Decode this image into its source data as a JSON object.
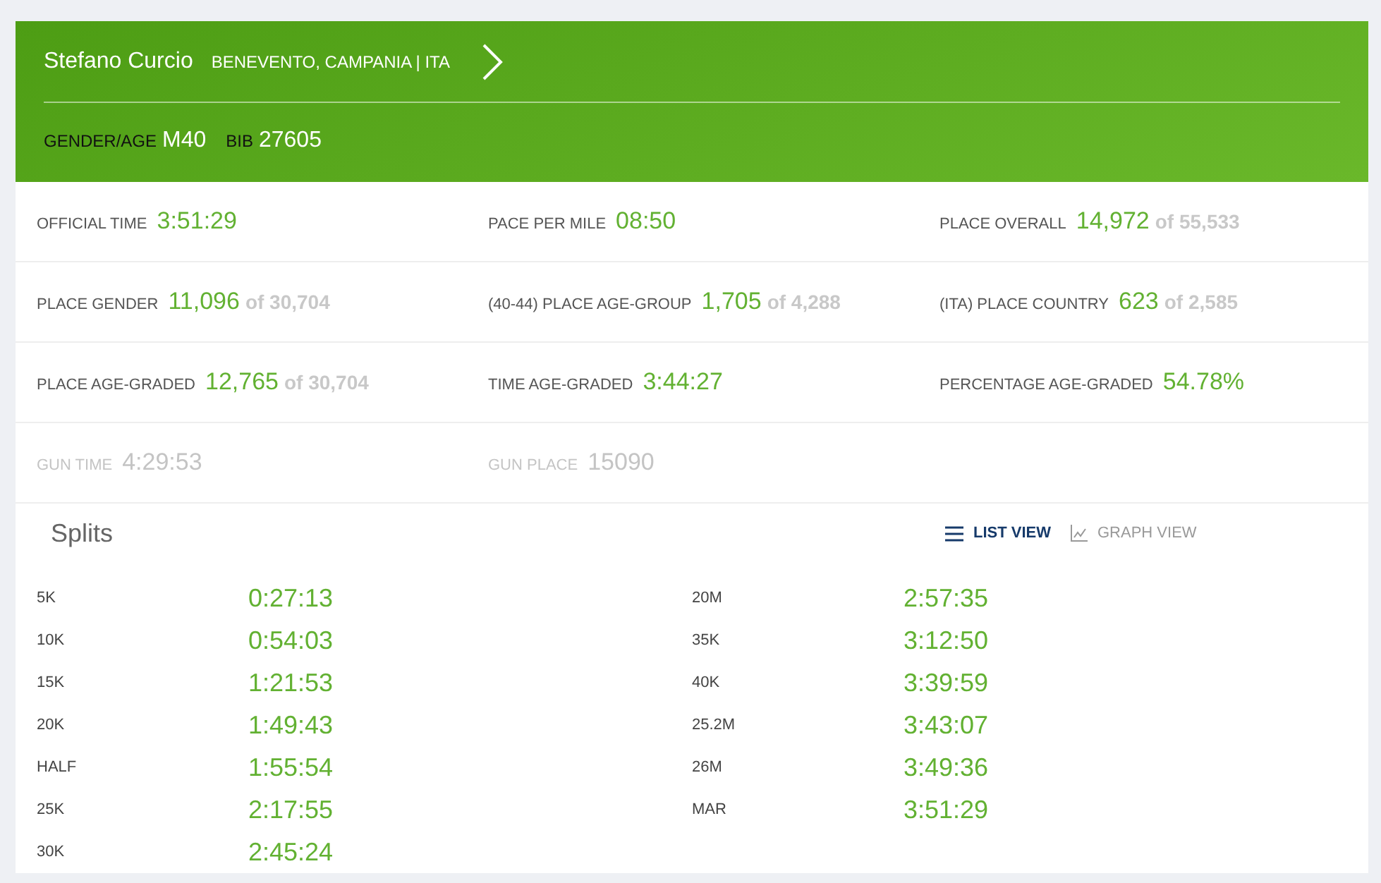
{
  "runner": {
    "name": "Stefano Curcio",
    "location": "BENEVENTO, CAMPANIA | ITA",
    "gender_age_label": "GENDER/AGE",
    "gender_age": "M40",
    "bib_label": "BIB",
    "bib": "27605"
  },
  "stats": [
    [
      {
        "label": "OFFICIAL TIME",
        "value": "3:51:29",
        "muted": false
      },
      {
        "label": "PACE PER MILE",
        "value": "08:50",
        "muted": false
      },
      {
        "label": "PLACE OVERALL",
        "value": "14,972",
        "of": "of 55,533",
        "muted": false
      }
    ],
    [
      {
        "label": "PLACE GENDER",
        "value": "11,096",
        "of": "of 30,704",
        "muted": false
      },
      {
        "label": "(40-44) PLACE AGE-GROUP",
        "value": "1,705",
        "of": "of 4,288",
        "muted": false
      },
      {
        "label": "(ITA) PLACE COUNTRY",
        "value": "623",
        "of": "of 2,585",
        "muted": false
      }
    ],
    [
      {
        "label": "PLACE AGE-GRADED",
        "value": "12,765",
        "of": "of 30,704",
        "muted": false
      },
      {
        "label": "TIME AGE-GRADED",
        "value": "3:44:27",
        "muted": false
      },
      {
        "label": "PERCENTAGE AGE-GRADED",
        "value": "54.78%",
        "muted": false
      }
    ],
    [
      {
        "label": "GUN TIME",
        "value": "4:29:53",
        "muted": true
      },
      {
        "label": "GUN PLACE",
        "value": "15090",
        "muted": true
      }
    ]
  ],
  "splits": {
    "title": "Splits",
    "views": [
      {
        "label": "LIST VIEW",
        "kind": "list",
        "selected": true
      },
      {
        "label": "GRAPH VIEW",
        "kind": "graph",
        "selected": false
      }
    ],
    "columns": [
      [
        {
          "point": "5K",
          "time": "0:27:13"
        },
        {
          "point": "10K",
          "time": "0:54:03"
        },
        {
          "point": "15K",
          "time": "1:21:53"
        },
        {
          "point": "20K",
          "time": "1:49:43"
        },
        {
          "point": "HALF",
          "time": "1:55:54"
        },
        {
          "point": "25K",
          "time": "2:17:55"
        },
        {
          "point": "30K",
          "time": "2:45:24"
        }
      ],
      [
        {
          "point": "20M",
          "time": "2:57:35"
        },
        {
          "point": "35K",
          "time": "3:12:50"
        },
        {
          "point": "40K",
          "time": "3:39:59"
        },
        {
          "point": "25.2M",
          "time": "3:43:07"
        },
        {
          "point": "26M",
          "time": "3:49:36"
        },
        {
          "point": "MAR",
          "time": "3:51:29"
        }
      ]
    ]
  }
}
